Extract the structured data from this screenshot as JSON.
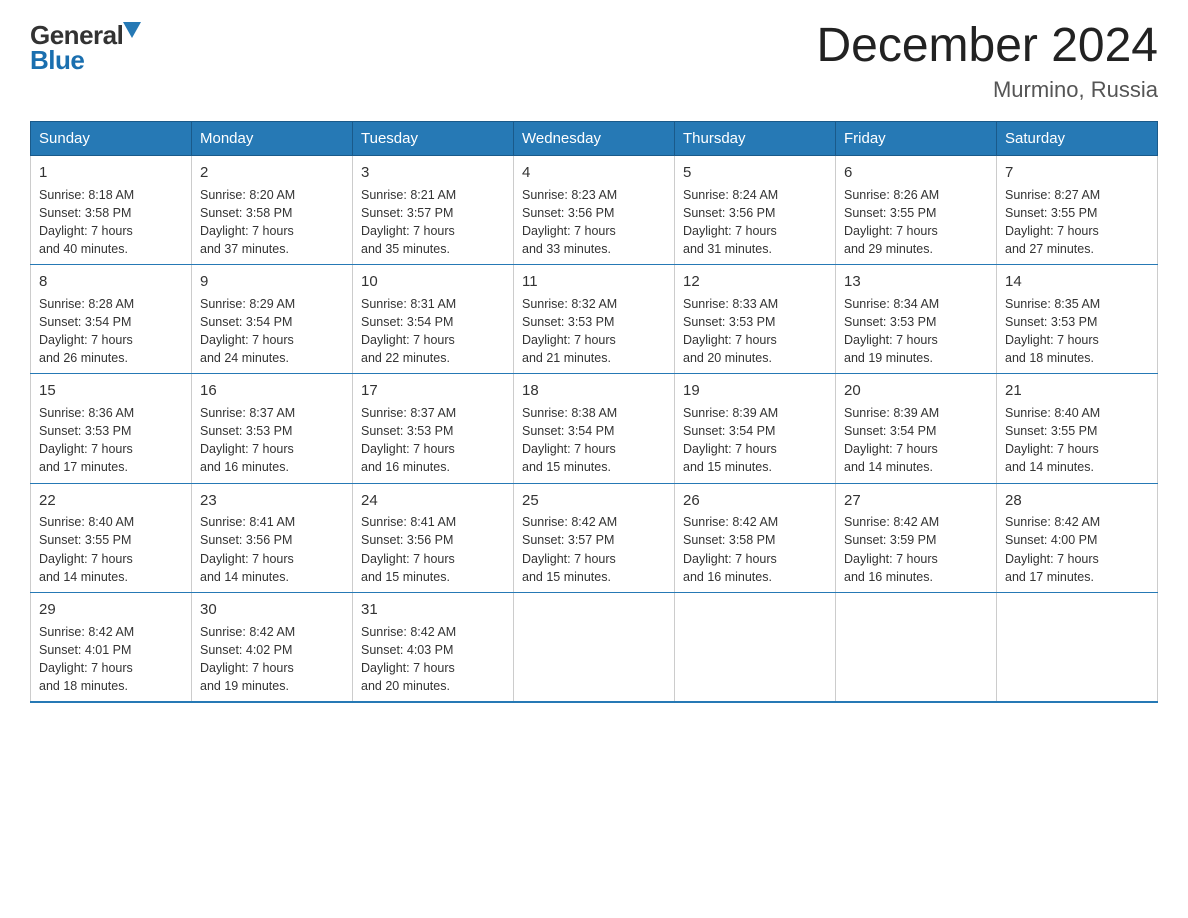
{
  "header": {
    "logo_general": "General",
    "logo_blue": "Blue",
    "month_title": "December 2024",
    "location": "Murmino, Russia"
  },
  "calendar": {
    "weekdays": [
      "Sunday",
      "Monday",
      "Tuesday",
      "Wednesday",
      "Thursday",
      "Friday",
      "Saturday"
    ],
    "weeks": [
      [
        {
          "day": "1",
          "sunrise": "8:18 AM",
          "sunset": "3:58 PM",
          "daylight": "7 hours and 40 minutes."
        },
        {
          "day": "2",
          "sunrise": "8:20 AM",
          "sunset": "3:58 PM",
          "daylight": "7 hours and 37 minutes."
        },
        {
          "day": "3",
          "sunrise": "8:21 AM",
          "sunset": "3:57 PM",
          "daylight": "7 hours and 35 minutes."
        },
        {
          "day": "4",
          "sunrise": "8:23 AM",
          "sunset": "3:56 PM",
          "daylight": "7 hours and 33 minutes."
        },
        {
          "day": "5",
          "sunrise": "8:24 AM",
          "sunset": "3:56 PM",
          "daylight": "7 hours and 31 minutes."
        },
        {
          "day": "6",
          "sunrise": "8:26 AM",
          "sunset": "3:55 PM",
          "daylight": "7 hours and 29 minutes."
        },
        {
          "day": "7",
          "sunrise": "8:27 AM",
          "sunset": "3:55 PM",
          "daylight": "7 hours and 27 minutes."
        }
      ],
      [
        {
          "day": "8",
          "sunrise": "8:28 AM",
          "sunset": "3:54 PM",
          "daylight": "7 hours and 26 minutes."
        },
        {
          "day": "9",
          "sunrise": "8:29 AM",
          "sunset": "3:54 PM",
          "daylight": "7 hours and 24 minutes."
        },
        {
          "day": "10",
          "sunrise": "8:31 AM",
          "sunset": "3:54 PM",
          "daylight": "7 hours and 22 minutes."
        },
        {
          "day": "11",
          "sunrise": "8:32 AM",
          "sunset": "3:53 PM",
          "daylight": "7 hours and 21 minutes."
        },
        {
          "day": "12",
          "sunrise": "8:33 AM",
          "sunset": "3:53 PM",
          "daylight": "7 hours and 20 minutes."
        },
        {
          "day": "13",
          "sunrise": "8:34 AM",
          "sunset": "3:53 PM",
          "daylight": "7 hours and 19 minutes."
        },
        {
          "day": "14",
          "sunrise": "8:35 AM",
          "sunset": "3:53 PM",
          "daylight": "7 hours and 18 minutes."
        }
      ],
      [
        {
          "day": "15",
          "sunrise": "8:36 AM",
          "sunset": "3:53 PM",
          "daylight": "7 hours and 17 minutes."
        },
        {
          "day": "16",
          "sunrise": "8:37 AM",
          "sunset": "3:53 PM",
          "daylight": "7 hours and 16 minutes."
        },
        {
          "day": "17",
          "sunrise": "8:37 AM",
          "sunset": "3:53 PM",
          "daylight": "7 hours and 16 minutes."
        },
        {
          "day": "18",
          "sunrise": "8:38 AM",
          "sunset": "3:54 PM",
          "daylight": "7 hours and 15 minutes."
        },
        {
          "day": "19",
          "sunrise": "8:39 AM",
          "sunset": "3:54 PM",
          "daylight": "7 hours and 15 minutes."
        },
        {
          "day": "20",
          "sunrise": "8:39 AM",
          "sunset": "3:54 PM",
          "daylight": "7 hours and 14 minutes."
        },
        {
          "day": "21",
          "sunrise": "8:40 AM",
          "sunset": "3:55 PM",
          "daylight": "7 hours and 14 minutes."
        }
      ],
      [
        {
          "day": "22",
          "sunrise": "8:40 AM",
          "sunset": "3:55 PM",
          "daylight": "7 hours and 14 minutes."
        },
        {
          "day": "23",
          "sunrise": "8:41 AM",
          "sunset": "3:56 PM",
          "daylight": "7 hours and 14 minutes."
        },
        {
          "day": "24",
          "sunrise": "8:41 AM",
          "sunset": "3:56 PM",
          "daylight": "7 hours and 15 minutes."
        },
        {
          "day": "25",
          "sunrise": "8:42 AM",
          "sunset": "3:57 PM",
          "daylight": "7 hours and 15 minutes."
        },
        {
          "day": "26",
          "sunrise": "8:42 AM",
          "sunset": "3:58 PM",
          "daylight": "7 hours and 16 minutes."
        },
        {
          "day": "27",
          "sunrise": "8:42 AM",
          "sunset": "3:59 PM",
          "daylight": "7 hours and 16 minutes."
        },
        {
          "day": "28",
          "sunrise": "8:42 AM",
          "sunset": "4:00 PM",
          "daylight": "7 hours and 17 minutes."
        }
      ],
      [
        {
          "day": "29",
          "sunrise": "8:42 AM",
          "sunset": "4:01 PM",
          "daylight": "7 hours and 18 minutes."
        },
        {
          "day": "30",
          "sunrise": "8:42 AM",
          "sunset": "4:02 PM",
          "daylight": "7 hours and 19 minutes."
        },
        {
          "day": "31",
          "sunrise": "8:42 AM",
          "sunset": "4:03 PM",
          "daylight": "7 hours and 20 minutes."
        },
        null,
        null,
        null,
        null
      ]
    ],
    "sunrise_label": "Sunrise:",
    "sunset_label": "Sunset:",
    "daylight_label": "Daylight:"
  }
}
